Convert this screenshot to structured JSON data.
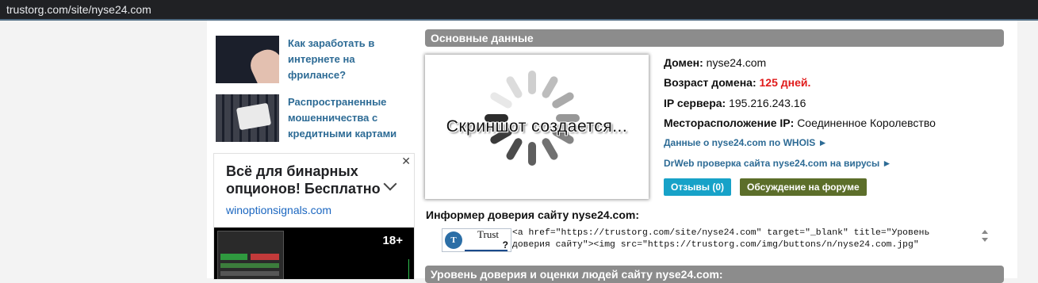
{
  "address_bar": {
    "url": "trustorg.com/site/nyse24.com"
  },
  "sidebar": {
    "articles": [
      {
        "title": "Как заработать в интернете на фрилансе?"
      },
      {
        "title": "Распространенные мошенничества с кредитными картами"
      }
    ],
    "ad": {
      "close": "✕",
      "headline": "Всё для бинарных опционов! Бесплатно",
      "domain": "winoptionsignals.com",
      "age_badge": "18+"
    }
  },
  "main": {
    "section_main_title": "Основные данные",
    "screenshot_text": "Скриншот создается...",
    "domain": {
      "label": "Домен:",
      "value": "nyse24.com"
    },
    "domain_age": {
      "label": "Возраст домена:",
      "value": "125 дней."
    },
    "ip": {
      "label": "IP сервера:",
      "value": "195.216.243.16"
    },
    "ip_location": {
      "label": "Месторасположение IP:",
      "value": "Соединенное Королевство"
    },
    "whois_link": "Данные о nyse24.com по WHOIS ►",
    "drweb_link": "DrWeb проверка сайта nyse24.com на вирусы ►",
    "buttons": {
      "reviews": "Отзывы (0)",
      "forum": "Обсуждение на форуме"
    },
    "informer_label": "Информер доверия сайту nyse24.com:",
    "trust_badge": {
      "word": "Trust",
      "mark": "?"
    },
    "informer_code": "<a href=\"https://trustorg.com/site/nyse24.com\" target=\"_blank\" title=\"Уровень\nдоверия сайту\"><img src=\"https://trustorg.com/img/buttons/n/nyse24.com.jpg\"",
    "section_trust_title": "Уровень доверия и оценки людей сайту nyse24.com:"
  },
  "colors": {
    "accent_link": "#2d6b95",
    "age_red": "#e01b1b",
    "reviews_button": "#17a2c8",
    "forum_button": "#5c6e2a",
    "section_bar": "#8c8c8c"
  }
}
